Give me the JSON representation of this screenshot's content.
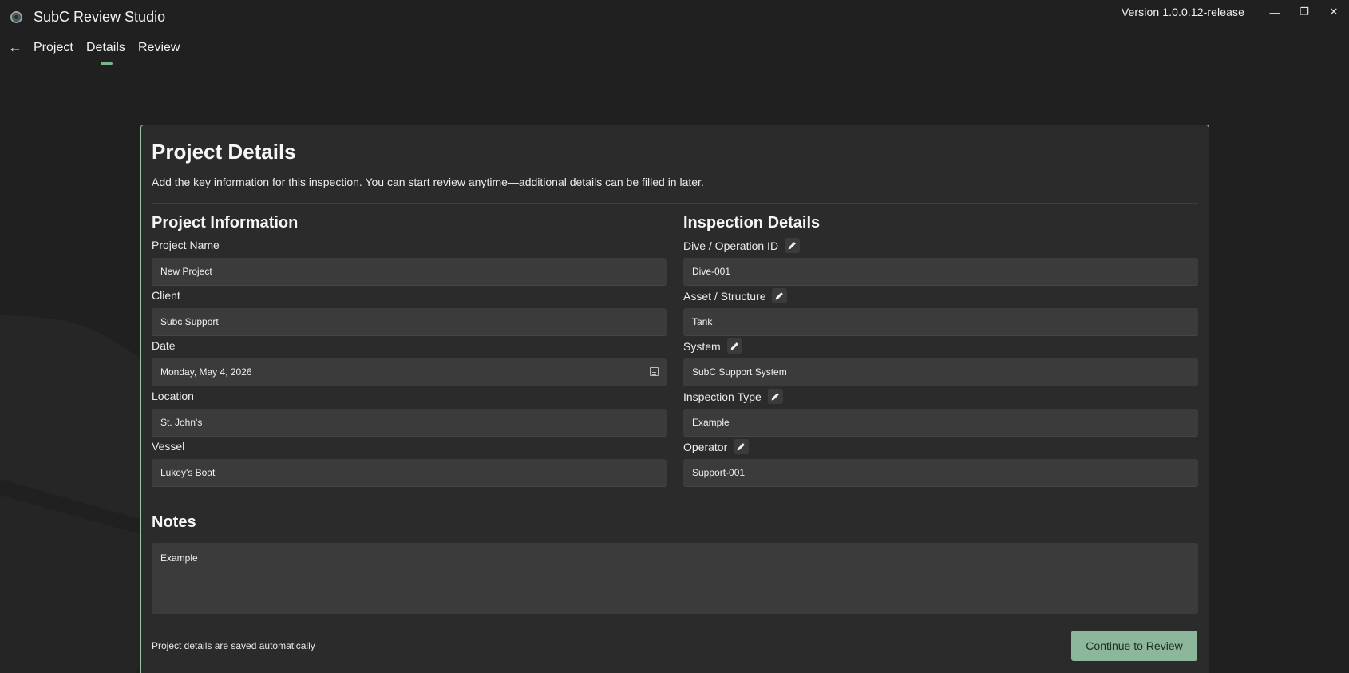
{
  "window": {
    "title": "SubC Review Studio",
    "version": "Version  1.0.0.12-release",
    "controls": {
      "minimize": "—",
      "maximize": "❐",
      "close": "✕"
    }
  },
  "nav": {
    "back_icon": "←",
    "tabs": [
      {
        "label": "Project"
      },
      {
        "label": "Details",
        "active": true
      },
      {
        "label": "Review"
      }
    ]
  },
  "card": {
    "title": "Project Details",
    "subtitle": "Add the key information for this inspection. You can start review anytime—additional details can be filled in later.",
    "project_info": {
      "heading": "Project Information",
      "fields": [
        {
          "label": "Project Name",
          "value": "New Project"
        },
        {
          "label": "Client",
          "value": "Subc Support"
        },
        {
          "label": "Date",
          "value": "Monday, May 4, 2026"
        },
        {
          "label": "Location",
          "value": "St. John's"
        },
        {
          "label": "Vessel",
          "value": "Lukey's Boat"
        }
      ]
    },
    "inspection": {
      "heading": "Inspection Details",
      "fields": [
        {
          "label": "Dive / Operation ID",
          "value": "Dive-001"
        },
        {
          "label": "Asset / Structure",
          "value": "Tank"
        },
        {
          "label": "System",
          "value": "SubC Support System"
        },
        {
          "label": "Inspection Type",
          "value": "Example"
        },
        {
          "label": "Operator",
          "value": "Support-001"
        }
      ]
    },
    "notes": {
      "heading": "Notes",
      "value": "Example"
    },
    "footer_note": "Project details are saved automatically",
    "continue_label": "Continue to Review"
  },
  "colors": {
    "background": "#202020",
    "card": "#2b2b2b",
    "field": "#3b3b3b",
    "accent": "#8cb79a",
    "card_border": "#98c4a7",
    "tab_indicator": "#79b58d"
  }
}
